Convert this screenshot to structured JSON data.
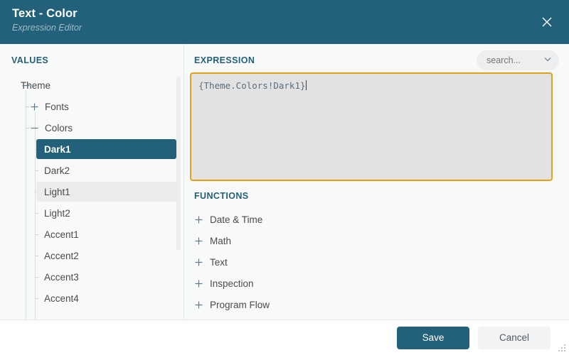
{
  "window": {
    "title": "Text - Color",
    "subtitle": "Expression Editor",
    "close_icon": "close-icon",
    "header_color": "#226179"
  },
  "values_panel": {
    "label": "VALUES",
    "tree": [
      {
        "label": "Theme",
        "depth": 0,
        "expander": "minus",
        "state": "normal"
      },
      {
        "label": "Fonts",
        "depth": 1,
        "expander": "plus",
        "state": "normal"
      },
      {
        "label": "Colors",
        "depth": 1,
        "expander": "minus",
        "state": "normal"
      },
      {
        "label": "Dark1",
        "depth": 2,
        "expander": "none",
        "state": "selected"
      },
      {
        "label": "Dark2",
        "depth": 2,
        "expander": "none",
        "state": "normal"
      },
      {
        "label": "Light1",
        "depth": 2,
        "expander": "none",
        "state": "hovered"
      },
      {
        "label": "Light2",
        "depth": 2,
        "expander": "none",
        "state": "normal"
      },
      {
        "label": "Accent1",
        "depth": 2,
        "expander": "none",
        "state": "normal"
      },
      {
        "label": "Accent2",
        "depth": 2,
        "expander": "none",
        "state": "normal"
      },
      {
        "label": "Accent3",
        "depth": 2,
        "expander": "none",
        "state": "normal"
      },
      {
        "label": "Accent4",
        "depth": 2,
        "expander": "none",
        "state": "normal"
      }
    ],
    "selected_color": "#226179",
    "hover_color": "#ececec"
  },
  "expression_panel": {
    "label": "EXPRESSION",
    "search": {
      "placeholder": "search...",
      "value": "",
      "chevron_icon": "chevron-down-icon"
    },
    "editor": {
      "text": "{Theme.Colors!Dark1}",
      "border_color": "#e3a11a",
      "background_color": "#e2e2e2",
      "text_color": "#5b6d7b"
    }
  },
  "functions_panel": {
    "label": "FUNCTIONS",
    "items": [
      {
        "label": "Date & Time",
        "expander": "plus"
      },
      {
        "label": "Math",
        "expander": "plus"
      },
      {
        "label": "Text",
        "expander": "plus"
      },
      {
        "label": "Inspection",
        "expander": "plus"
      },
      {
        "label": "Program Flow",
        "expander": "plus"
      }
    ]
  },
  "footer": {
    "save_label": "Save",
    "cancel_label": "Cancel",
    "save_color": "#226179",
    "cancel_color": "#f2f3f4"
  }
}
